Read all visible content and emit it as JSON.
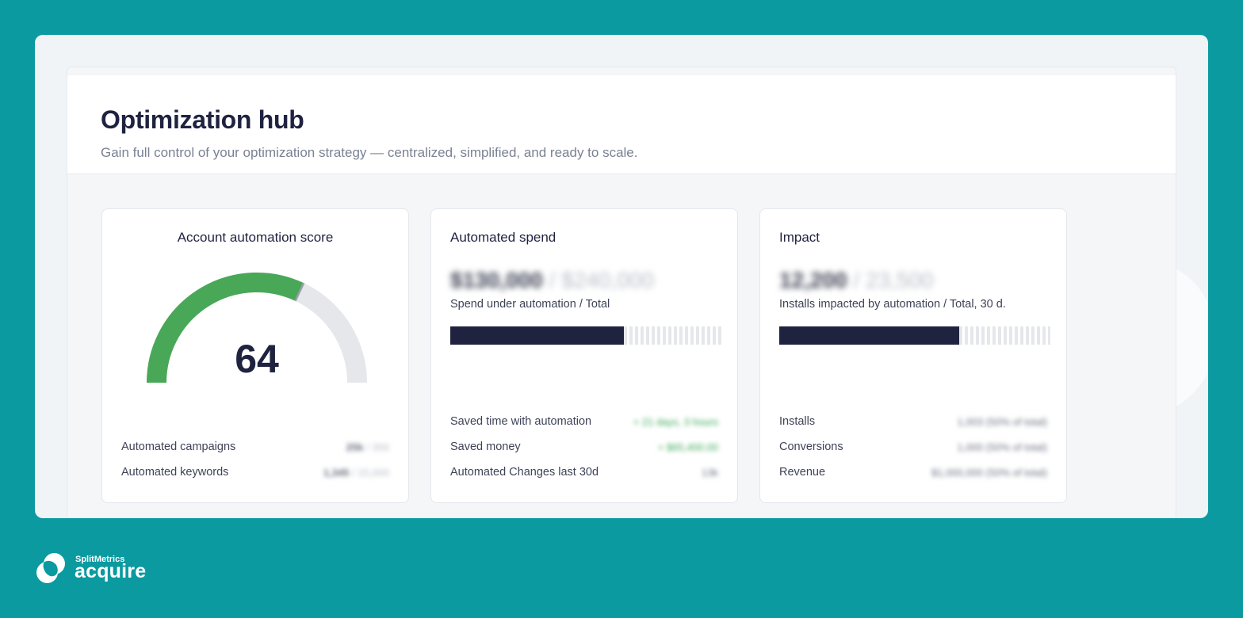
{
  "header": {
    "title": "Optimization hub",
    "subtitle": "Gain full control of your optimization strategy — centralized, simplified, and ready to scale."
  },
  "score_card": {
    "title": "Account automation score",
    "score": "64",
    "score_fraction": 0.64,
    "colors": {
      "filled": "#48a857",
      "track": "#e6e7eb"
    },
    "stats": [
      {
        "label": "Automated campaigns",
        "value": "25k",
        "total": "/ 300"
      },
      {
        "label": "Automated keywords",
        "value": "1,345",
        "total": "/ 15,000"
      }
    ]
  },
  "spend_card": {
    "title": "Automated spend",
    "value": "$130,000",
    "total": "/ $240,000",
    "caption": "Spend under automation / Total",
    "progress_fraction": 0.64,
    "stats": [
      {
        "label": "Saved time with automation",
        "value": "+ 21 days, 3 hours",
        "tone": "green"
      },
      {
        "label": "Saved money",
        "value": "+ $65,400.00",
        "tone": "green"
      },
      {
        "label": "Automated Changes last 30d",
        "value": "13k",
        "tone": "dark"
      }
    ]
  },
  "impact_card": {
    "title": "Impact",
    "value": "12,200",
    "total": "/ 23,500",
    "caption": "Installs impacted by automation / Total, 30 d.",
    "progress_fraction": 0.665,
    "stats": [
      {
        "label": "Installs",
        "value": "1,003 (50% of total)"
      },
      {
        "label": "Conversions",
        "value": "1,000 (50% of total)"
      },
      {
        "label": "Revenue",
        "value": "$1,000,000 (50% of total)"
      }
    ]
  },
  "brand": {
    "company": "SplitMetrics",
    "product": "acquire",
    "accent": "#0a9aa0"
  }
}
